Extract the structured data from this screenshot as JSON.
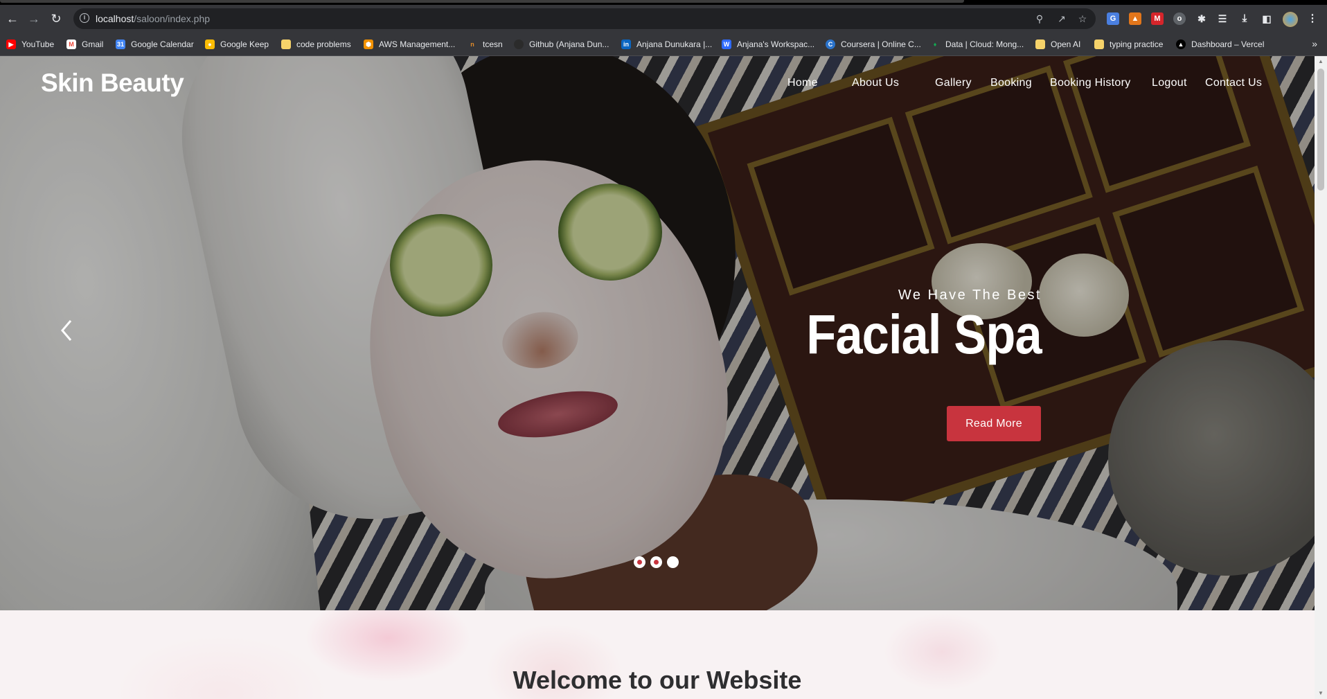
{
  "browser": {
    "url_host": "localhost",
    "url_path": "/saloon/index.php",
    "bookmarks": [
      {
        "label": "YouTube",
        "icon": "youtube-icon",
        "color": "#ff0000"
      },
      {
        "label": "Gmail",
        "icon": "gmail-icon",
        "color": "#ea4335"
      },
      {
        "label": "Google Calendar",
        "icon": "calendar-icon",
        "color": "#4285f4"
      },
      {
        "label": "Google Keep",
        "icon": "keep-icon",
        "color": "#fbbc04"
      },
      {
        "label": "code problems",
        "icon": "folder-icon",
        "color": "#f6d36a"
      },
      {
        "label": "AWS Management...",
        "icon": "aws-icon",
        "color": "#f29100"
      },
      {
        "label": "tcesn",
        "icon": "tcesn-icon",
        "color": "#c66a00"
      },
      {
        "label": "Github (Anjana Dun...",
        "icon": "github-icon",
        "color": "#2b2b2b"
      },
      {
        "label": "Anjana Dunukara |...",
        "icon": "linkedin-icon",
        "color": "#0a66c2"
      },
      {
        "label": "Anjana's Workspac...",
        "icon": "workspace-icon",
        "color": "#2f6bff"
      },
      {
        "label": "Coursera | Online C...",
        "icon": "coursera-icon",
        "color": "#2a73cc"
      },
      {
        "label": "Data | Cloud: Mong...",
        "icon": "mongodb-icon",
        "color": "#13aa52"
      },
      {
        "label": "Open AI",
        "icon": "folder-icon",
        "color": "#f6d36a"
      },
      {
        "label": "typing practice",
        "icon": "folder-icon",
        "color": "#f6d36a"
      },
      {
        "label": "Dashboard – Vercel",
        "icon": "vercel-icon",
        "color": "#000000"
      }
    ],
    "more_label": "»"
  },
  "site": {
    "logo": "Skin Beauty",
    "nav": [
      "Home",
      "About Us",
      "Gallery",
      "Booking",
      "Booking History",
      "Logout",
      "Contact Us"
    ]
  },
  "hero": {
    "subtitle": "We Have The Best",
    "title": "Facial Spa",
    "button": "Read More",
    "slides_total": 3,
    "active_slide": 3
  },
  "welcome": {
    "title": "Welcome to our Website"
  },
  "colors": {
    "accent": "#c8343e",
    "chrome_bg": "#35363a",
    "omnibox_bg": "#202124"
  }
}
